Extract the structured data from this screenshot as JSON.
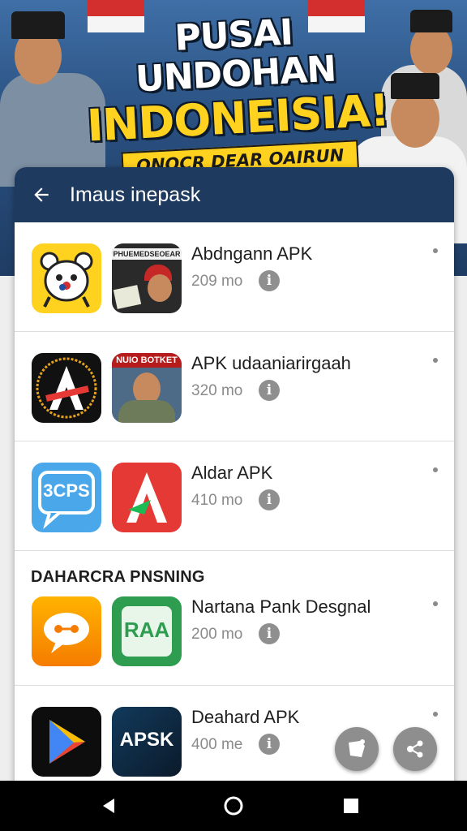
{
  "banner": {
    "line1": "PUSAI UNDOHAN",
    "line2": "INDONEISIA!",
    "subtitle": "ONOCR DEAR OAIRUN"
  },
  "header": {
    "title": "Imaus inepask"
  },
  "apps": [
    {
      "name": "Abdngann APK",
      "size": "209 mo",
      "thumb_text": "PHUEMEDSEOEAR",
      "icon1": "kawaii-face-icon",
      "icon2": "photo-thumbnail"
    },
    {
      "name": "APK udaaniarirgaah",
      "size": "320 mo",
      "thumb_text": "NUIO BOTKET",
      "icon1": "letter-a-badge-icon",
      "icon2": "photo-thumbnail"
    },
    {
      "name": "Aldar APK",
      "size": "410 mo",
      "icon1_text": "3CPS",
      "icon1": "chat-bubble-icon",
      "icon2": "letter-a-red-icon"
    },
    {
      "name": "Nartana Pank Desgnal",
      "size": "200 mo",
      "icon1": "speech-bubble-icon",
      "icon2_text": "RAA",
      "icon2": "green-a-icon"
    },
    {
      "name": "Deahard APK",
      "size": "400 me",
      "icon1": "play-store-icon",
      "icon2_text": "APSK",
      "icon2": "apsk-icon"
    }
  ],
  "section": {
    "title": "DAHARCRA PNSNING"
  },
  "colors": {
    "header_bg": "#1e3a5f",
    "accent_yellow": "#ffd21f"
  },
  "navbar": {
    "back": "back-triangle-icon",
    "home": "home-circle-icon",
    "recents": "recents-square-icon"
  }
}
